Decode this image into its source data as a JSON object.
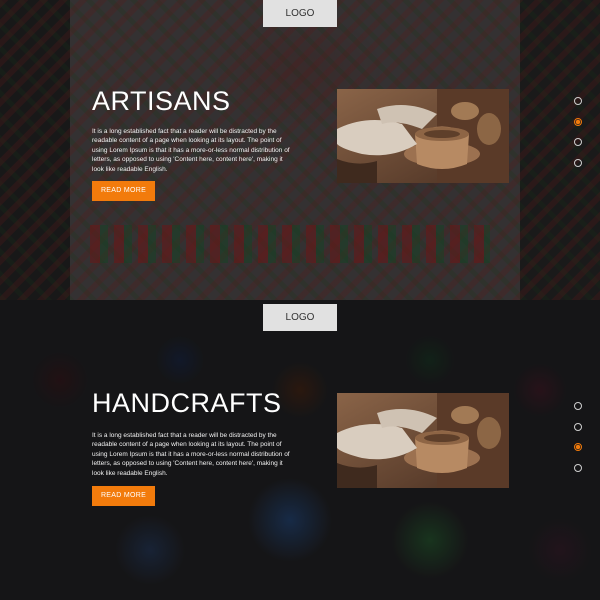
{
  "slides": [
    {
      "logo": "LOGO",
      "title": "ARTISANS",
      "description": "It is a long established fact that a reader will be distracted by the readable content of a page when looking at its layout. The point of using Lorem Ipsum is that it has a more-or-less normal distribution of letters, as opposed to using 'Content here, content here', making it look like readable English.",
      "button": "READ MORE",
      "active_dot": 2,
      "dot_count": 4
    },
    {
      "logo": "LOGO",
      "title": "HANDCRAFTS",
      "description": "It is a long established fact that a reader will be distracted by the readable content of a page when looking at its layout. The point of using Lorem Ipsum is that it has a more-or-less normal distribution of letters, as opposed to using 'Content here, content here', making it look like readable English.",
      "button": "READ MORE",
      "active_dot": 3,
      "dot_count": 4
    }
  ],
  "colors": {
    "accent": "#f27b0c",
    "logo_bg": "#e1e1e1"
  }
}
